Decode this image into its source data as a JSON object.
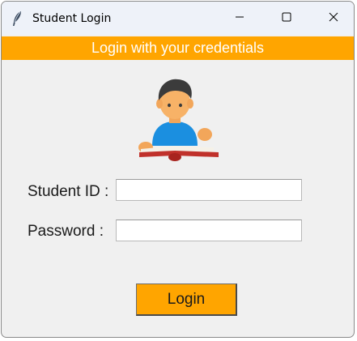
{
  "window": {
    "title": "Student Login",
    "app_icon": "feather-icon",
    "controls": {
      "minimize_icon": "minimize-icon",
      "maximize_icon": "maximize-icon",
      "close_icon": "close-icon"
    }
  },
  "banner": {
    "text": "Login with your credentials",
    "background": "#ffa500",
    "color": "#ffffff"
  },
  "avatar": {
    "icon": "student-reading-icon"
  },
  "form": {
    "student_id": {
      "label": "Student ID :",
      "value": ""
    },
    "password": {
      "label": "Password :",
      "value": ""
    },
    "login_label": "Login"
  },
  "colors": {
    "accent": "#ffa500",
    "window_background": "#f0f0f0",
    "titlebar": "#eef2f9"
  }
}
